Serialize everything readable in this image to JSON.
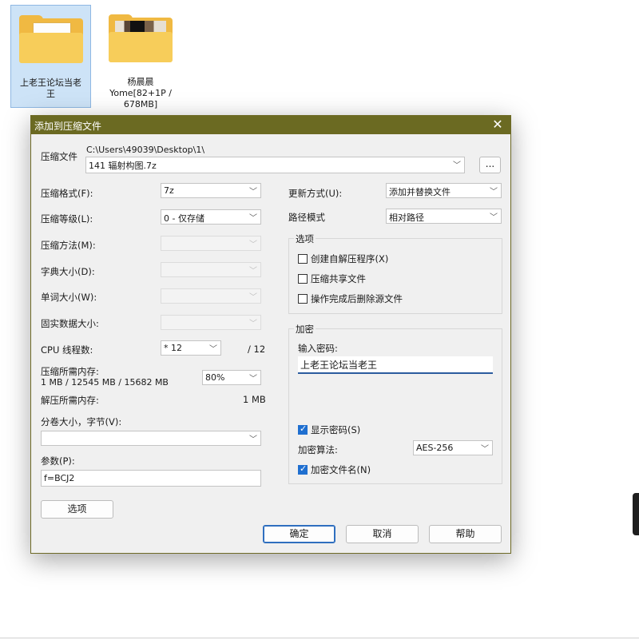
{
  "desktop": {
    "icons": [
      {
        "label": "上老王论坛当老王"
      },
      {
        "label": "杨晨晨 Yome[82+1P / 678MB]"
      }
    ]
  },
  "dialog": {
    "title": "添加到压缩文件",
    "archive": {
      "label": "压缩文件",
      "path": "C:\\Users\\49039\\Desktop\\1\\",
      "filename": "141 辐射构图.7z",
      "browse_label": "..."
    },
    "left": {
      "format": {
        "label": "压缩格式(F):",
        "value": "7z"
      },
      "level": {
        "label": "压缩等级(L):",
        "value": "0 - 仅存储"
      },
      "method": {
        "label": "压缩方法(M):",
        "value": ""
      },
      "dict": {
        "label": "字典大小(D):",
        "value": ""
      },
      "word": {
        "label": "单词大小(W):",
        "value": ""
      },
      "solid": {
        "label": "固实数据大小:",
        "value": ""
      },
      "cpu": {
        "label": "CPU 线程数:",
        "value": "* 12",
        "max": "/ 12"
      },
      "mem_compress": {
        "label": "压缩所需内存:",
        "detail": "1 MB / 12545 MB / 15682 MB",
        "value": "80%"
      },
      "mem_decompress": {
        "label": "解压所需内存:",
        "value": "1 MB"
      },
      "split": {
        "label": "分卷大小，字节(V):",
        "value": ""
      },
      "params": {
        "label": "参数(P):",
        "value": "f=BCJ2"
      },
      "options_button": "选项"
    },
    "right": {
      "update": {
        "label": "更新方式(U):",
        "value": "添加并替换文件"
      },
      "pathmode": {
        "label": "路径模式",
        "value": "相对路径"
      },
      "options_group": {
        "title": "选项",
        "sfx": {
          "label": "创建自解压程序(X)",
          "checked": false
        },
        "shared": {
          "label": "压缩共享文件",
          "checked": false
        },
        "delete": {
          "label": "操作完成后删除源文件",
          "checked": false
        }
      },
      "encryption": {
        "title": "加密",
        "password_label": "输入密码:",
        "password_value": "上老王论坛当老王",
        "show_password": {
          "label": "显示密码(S)",
          "checked": true
        },
        "method_label": "加密算法:",
        "method_value": "AES-256",
        "encrypt_names": {
          "label": "加密文件名(N)",
          "checked": true
        }
      }
    },
    "buttons": {
      "ok": "确定",
      "cancel": "取消",
      "help": "帮助"
    }
  },
  "colors": {
    "titlebar": "#6b6a22",
    "accent": "#1f6fd0"
  }
}
